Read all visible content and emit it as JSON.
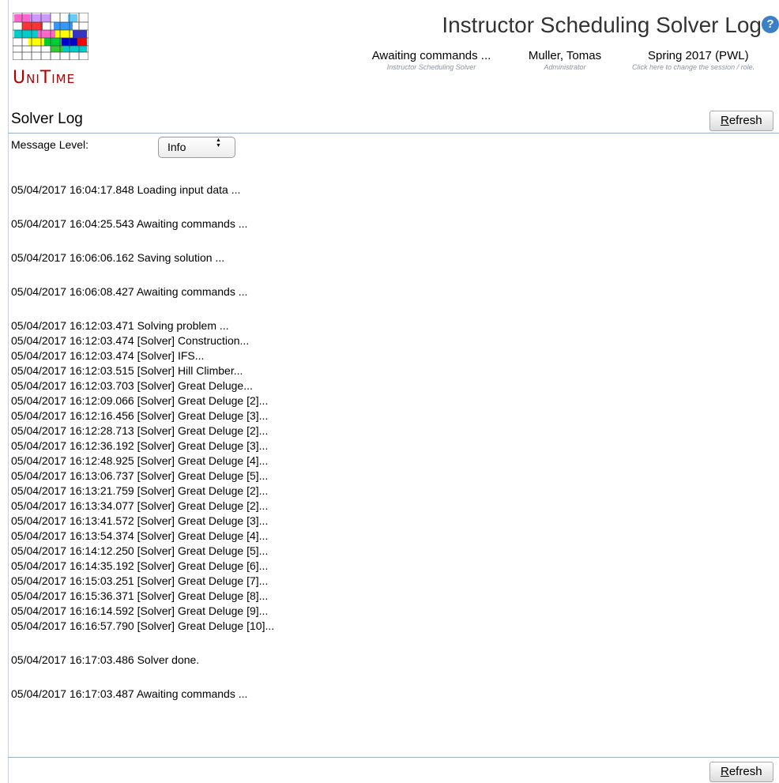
{
  "brand": {
    "logo_text": "UniTime"
  },
  "header": {
    "title": "Instructor Scheduling Solver Log",
    "help_icon": "help-question-icon",
    "solver_status": "Awaiting commands ...",
    "solver_label": "Instructor Scheduling Solver",
    "user_name": "Muller, Tomas",
    "user_role": "Administrator",
    "session": "Spring 2017 (PWL)",
    "session_hint": "Click here to change the session / role."
  },
  "section": {
    "title": "Solver Log",
    "refresh_label": "Refresh"
  },
  "filter": {
    "label": "Message Level:",
    "selected": "Info"
  },
  "log": {
    "groups": [
      [
        "05/04/2017 16:04:17.848 Loading input data ..."
      ],
      [
        "05/04/2017 16:04:25.543 Awaiting commands ..."
      ],
      [
        "05/04/2017 16:06:06.162 Saving solution ..."
      ],
      [
        "05/04/2017 16:06:08.427 Awaiting commands ..."
      ],
      [
        "05/04/2017 16:12:03.471 Solving problem ...",
        "05/04/2017 16:12:03.474 [Solver] Construction...",
        "05/04/2017 16:12:03.474 [Solver] IFS...",
        "05/04/2017 16:12:03.515 [Solver] Hill Climber...",
        "05/04/2017 16:12:03.703 [Solver] Great Deluge...",
        "05/04/2017 16:12:09.066 [Solver] Great Deluge [2]...",
        "05/04/2017 16:12:16.456 [Solver] Great Deluge [3]...",
        "05/04/2017 16:12:28.713 [Solver] Great Deluge [2]...",
        "05/04/2017 16:12:36.192 [Solver] Great Deluge [3]...",
        "05/04/2017 16:12:48.925 [Solver] Great Deluge [4]...",
        "05/04/2017 16:13:06.737 [Solver] Great Deluge [5]...",
        "05/04/2017 16:13:21.759 [Solver] Great Deluge [2]...",
        "05/04/2017 16:13:34.077 [Solver] Great Deluge [2]...",
        "05/04/2017 16:13:41.572 [Solver] Great Deluge [3]...",
        "05/04/2017 16:13:54.374 [Solver] Great Deluge [4]...",
        "05/04/2017 16:14:12.250 [Solver] Great Deluge [5]...",
        "05/04/2017 16:14:35.192 [Solver] Great Deluge [6]...",
        "05/04/2017 16:15:03.251 [Solver] Great Deluge [7]...",
        "05/04/2017 16:15:36.371 [Solver] Great Deluge [8]...",
        "05/04/2017 16:16:14.592 [Solver] Great Deluge [9]...",
        "05/04/2017 16:16:57.790 [Solver] Great Deluge [10]..."
      ],
      [
        "05/04/2017 16:17:03.486 Solver done."
      ],
      [
        "05/04/2017 16:17:03.487 Awaiting commands ..."
      ]
    ]
  }
}
